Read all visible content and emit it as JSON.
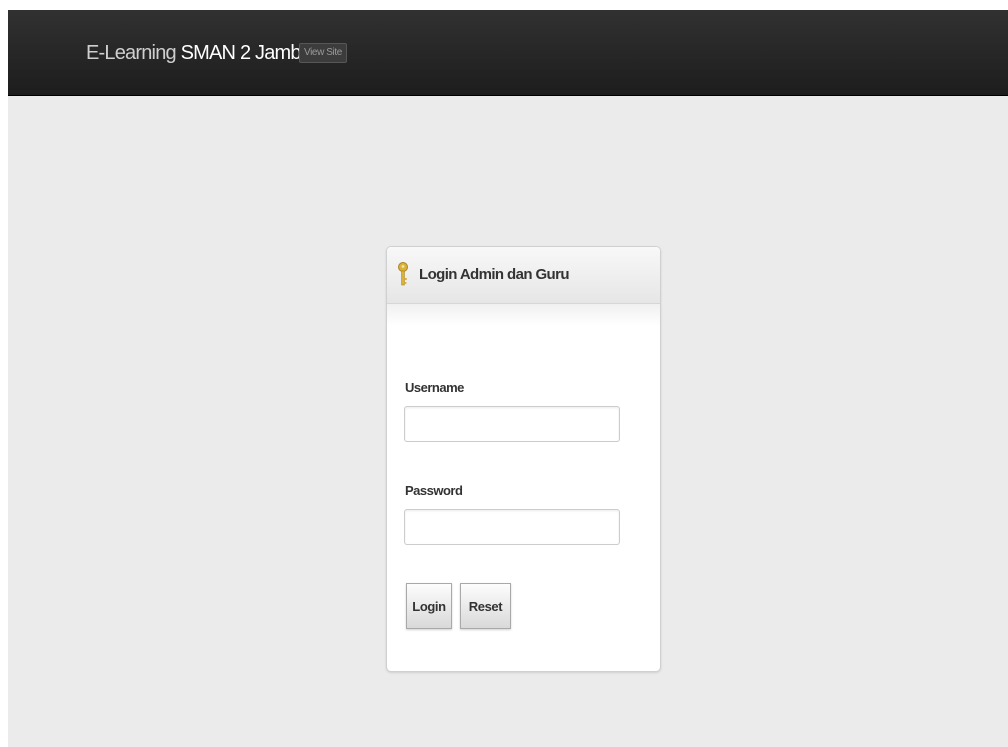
{
  "navbar": {
    "brand_prefix": "E-Learning ",
    "brand_name": "SMAN 2 Jambi",
    "view_site_label": "View Site"
  },
  "login_box": {
    "title": "Login Admin dan Guru",
    "icon": "key-icon",
    "username_label": "Username",
    "username_value": "",
    "password_label": "Password",
    "password_value": "",
    "login_button": "Login",
    "reset_button": "Reset"
  },
  "colors": {
    "navbar": "#262626",
    "page_background": "#ebebeb",
    "key_icon": "#d9b23a"
  }
}
